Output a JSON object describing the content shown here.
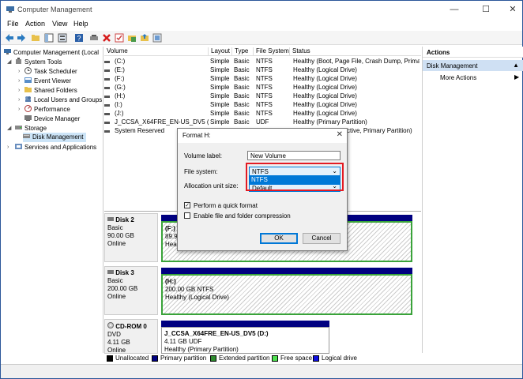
{
  "window": {
    "title": "Computer Management",
    "minimize": "—",
    "maximize": "☐",
    "close": "✕"
  },
  "menu": [
    "File",
    "Action",
    "View",
    "Help"
  ],
  "tree": {
    "root": "Computer Management (Local",
    "system_tools": "System Tools",
    "task_scheduler": "Task Scheduler",
    "event_viewer": "Event Viewer",
    "shared_folders": "Shared Folders",
    "local_users": "Local Users and Groups",
    "performance": "Performance",
    "device_manager": "Device Manager",
    "storage": "Storage",
    "disk_management": "Disk Management",
    "services": "Services and Applications"
  },
  "volumes": {
    "headers": [
      "Volume",
      "Layout",
      "Type",
      "File System",
      "Status"
    ],
    "rows": [
      [
        "(C:)",
        "Simple",
        "Basic",
        "NTFS",
        "Healthy (Boot, Page File, Crash Dump, Primar"
      ],
      [
        "(E:)",
        "Simple",
        "Basic",
        "NTFS",
        "Healthy (Logical Drive)"
      ],
      [
        "(F:)",
        "Simple",
        "Basic",
        "NTFS",
        "Healthy (Logical Drive)"
      ],
      [
        "(G:)",
        "Simple",
        "Basic",
        "NTFS",
        "Healthy (Logical Drive)"
      ],
      [
        "(H:)",
        "Simple",
        "Basic",
        "NTFS",
        "Healthy (Logical Drive)"
      ],
      [
        "(I:)",
        "Simple",
        "Basic",
        "NTFS",
        "Healthy (Logical Drive)"
      ],
      [
        "(J:)",
        "Simple",
        "Basic",
        "NTFS",
        "Healthy (Logical Drive)"
      ],
      [
        "J_CCSA_X64FRE_EN-US_DV5 (D:)",
        "Simple",
        "Basic",
        "UDF",
        "Healthy (Primary Partition)"
      ],
      [
        "System Reserved",
        "Simple",
        "Basic",
        "NTFS",
        "Healthy (System, Active, Primary Partition)"
      ]
    ]
  },
  "disks": {
    "disk2": {
      "name": "Disk 2",
      "type": "Basic",
      "size": "90.00 GB",
      "state": "Online",
      "part_letter": "(F:)",
      "part_size": "89.9",
      "part_status": "Heal"
    },
    "disk3": {
      "name": "Disk 3",
      "type": "Basic",
      "size": "200.00 GB",
      "state": "Online",
      "part_letter": "(H:)",
      "part_size": "200.00 GB NTFS",
      "part_status": "Healthy (Logical Drive)"
    },
    "cdrom": {
      "name": "CD-ROM 0",
      "type": "DVD",
      "size": "4.11 GB",
      "state": "Online",
      "part_letter": "J_CCSA_X64FRE_EN-US_DV5  (D:)",
      "part_size": "4.11 GB UDF",
      "part_status": "Healthy (Primary Partition)"
    }
  },
  "legend": {
    "unallocated": "Unallocated",
    "primary": "Primary partition",
    "extended": "Extended partition",
    "free": "Free space",
    "logical": "Logical drive",
    "colors": {
      "unallocated": "#000000",
      "primary": "#000080",
      "extended": "#2e8b2e",
      "free": "#50e050",
      "logical": "#1010e0"
    }
  },
  "actions": {
    "header": "Actions",
    "section": "Disk Management",
    "more": "More Actions"
  },
  "dialog": {
    "title": "Format H:",
    "volume_label": "Volume label:",
    "volume_value": "New Volume",
    "file_system": "File system:",
    "file_system_value": "NTFS",
    "file_system_option": "NTFS",
    "alloc_label": "Allocation unit size:",
    "alloc_value": "Default",
    "quick_format": "Perform a quick format",
    "quick_format_checked": true,
    "compression": "Enable file and folder compression",
    "compression_checked": false,
    "ok": "OK",
    "cancel": "Cancel"
  }
}
